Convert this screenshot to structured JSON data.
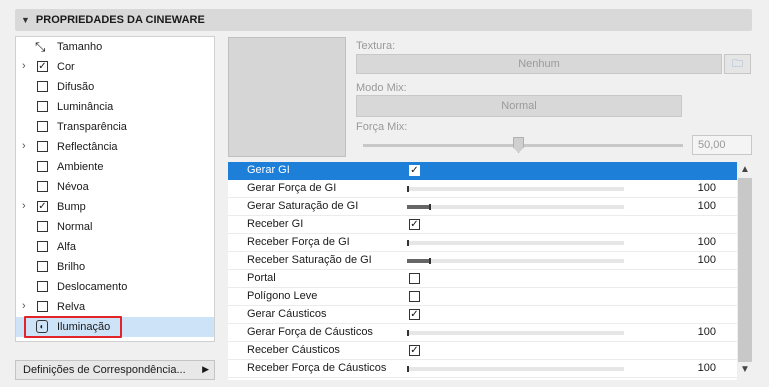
{
  "header": {
    "title": "PROPRIEDADES DA CINEWARE"
  },
  "left_items": [
    {
      "label": "Tamanho",
      "expandable": false,
      "icon": "size"
    },
    {
      "label": "Cor",
      "expandable": true,
      "checked": true
    },
    {
      "label": "Difusão",
      "expandable": false,
      "checked": false
    },
    {
      "label": "Luminância",
      "expandable": false,
      "checked": false
    },
    {
      "label": "Transparência",
      "expandable": false,
      "checked": false
    },
    {
      "label": "Reflectância",
      "expandable": true,
      "checked": false
    },
    {
      "label": "Ambiente",
      "expandable": false,
      "checked": false
    },
    {
      "label": "Névoa",
      "expandable": false,
      "checked": false
    },
    {
      "label": "Bump",
      "expandable": true,
      "checked": true
    },
    {
      "label": "Normal",
      "expandable": false,
      "checked": false
    },
    {
      "label": "Alfa",
      "expandable": false,
      "checked": false
    },
    {
      "label": "Brilho",
      "expandable": false,
      "checked": false
    },
    {
      "label": "Deslocamento",
      "expandable": false,
      "checked": false
    },
    {
      "label": "Relva",
      "expandable": true,
      "checked": false
    },
    {
      "label": "Iluminação",
      "expandable": false,
      "icon": "lamp",
      "selected": true
    }
  ],
  "bottom_button": {
    "label": "Definições de Correspondência..."
  },
  "texture": {
    "texture_label": "Textura:",
    "texture_value": "Nenhum",
    "mode_label": "Modo Mix:",
    "mode_value": "Normal",
    "strength_label": "Força Mix:",
    "strength_value": "50,00"
  },
  "rows": [
    {
      "name": "Gerar GI",
      "type": "check",
      "checked": true,
      "selected": true
    },
    {
      "name": "Gerar Força de GI",
      "type": "slider",
      "value": "100",
      "fill": 0.0
    },
    {
      "name": "Gerar Saturação de GI",
      "type": "slider",
      "value": "100",
      "fill": 0.1
    },
    {
      "name": "Receber GI",
      "type": "check",
      "checked": true
    },
    {
      "name": "Receber Força de GI",
      "type": "slider",
      "value": "100",
      "fill": 0.0
    },
    {
      "name": "Receber Saturação de GI",
      "type": "slider",
      "value": "100",
      "fill": 0.1
    },
    {
      "name": "Portal",
      "type": "check",
      "checked": false
    },
    {
      "name": "Polígono Leve",
      "type": "check",
      "checked": false
    },
    {
      "name": "Gerar Cáusticos",
      "type": "check",
      "checked": true
    },
    {
      "name": "Gerar Força de Cáusticos",
      "type": "slider",
      "value": "100",
      "fill": 0.0
    },
    {
      "name": "Receber Cáusticos",
      "type": "check",
      "checked": true
    },
    {
      "name": "Receber Força de Cáusticos",
      "type": "slider",
      "value": "100",
      "fill": 0.0
    }
  ],
  "colors": {
    "selection": "#1e7fd8",
    "highlight": "#e0242a"
  }
}
